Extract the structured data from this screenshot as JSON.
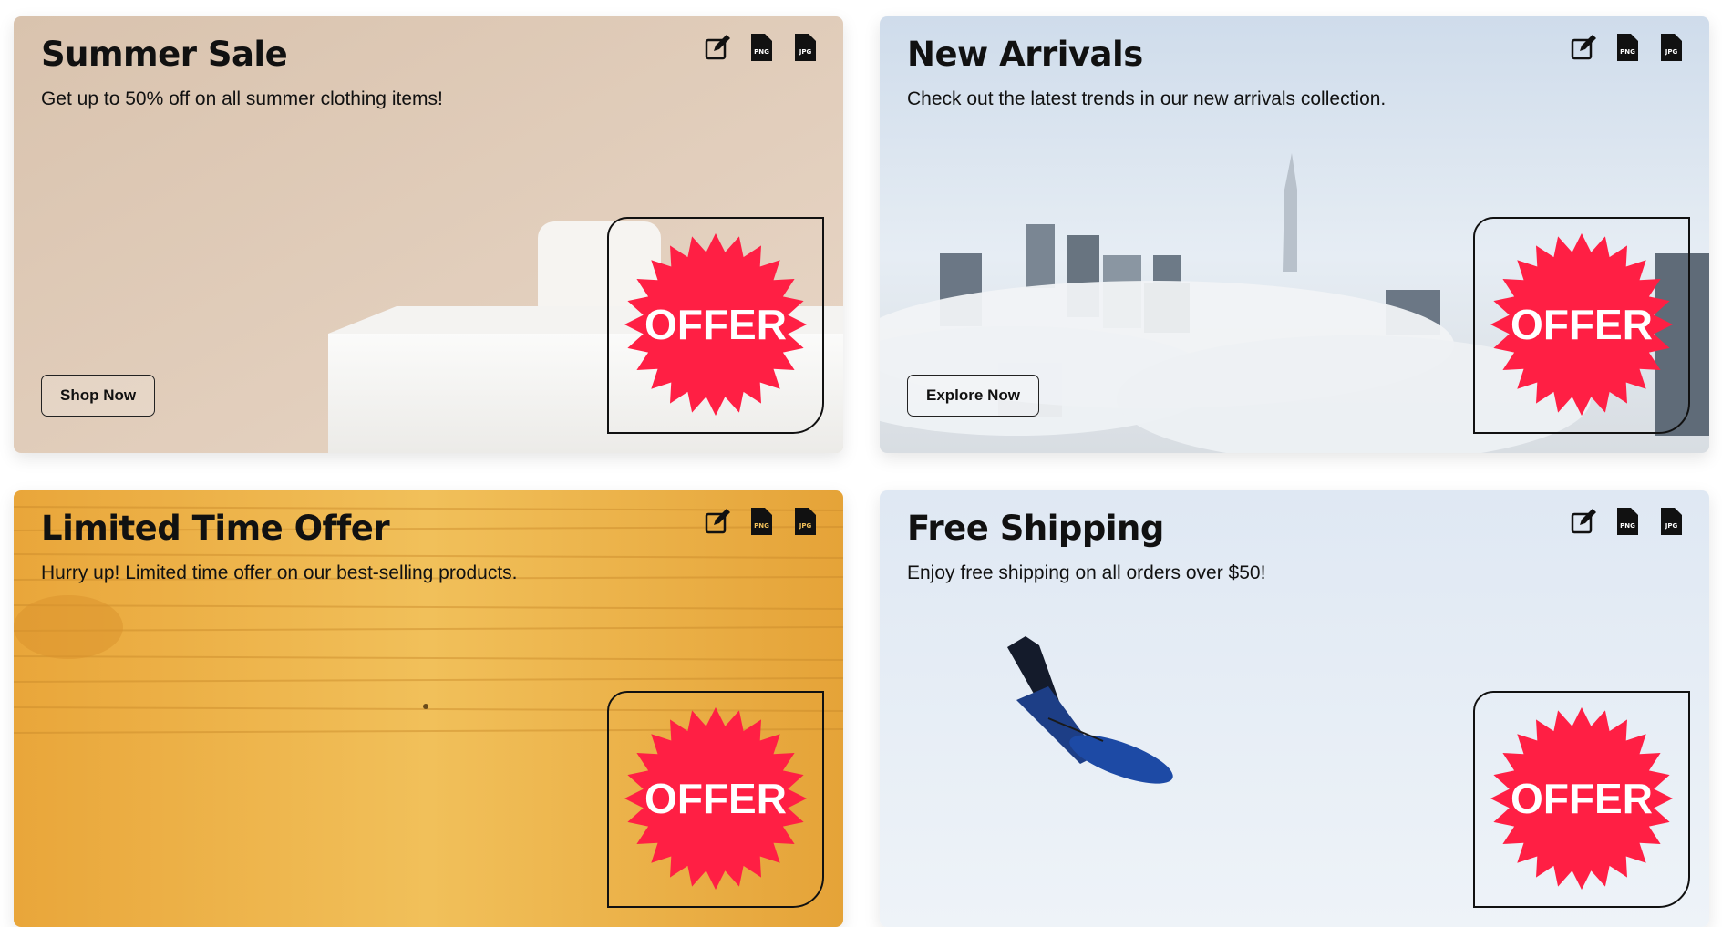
{
  "brand": {
    "badge_color": "#ff1f44"
  },
  "icons": [
    "edit-icon",
    "png-file-icon",
    "jpg-file-icon"
  ],
  "icon_labels": {
    "png": "PNG",
    "jpg": "JPG"
  },
  "cards": [
    {
      "title": "Summer Sale",
      "description": "Get up to 50% off on all summer clothing items!",
      "button": "Shop Now",
      "badge": "OFFER"
    },
    {
      "title": "New Arrivals",
      "description": "Check out the latest trends in our new arrivals collection.",
      "button": "Explore Now",
      "badge": "OFFER"
    },
    {
      "title": "Limited Time Offer",
      "description": "Hurry up! Limited time offer on our best-selling products.",
      "button": "",
      "badge": "OFFER"
    },
    {
      "title": "Free Shipping",
      "description": "Enjoy free shipping on all orders over $50!",
      "button": "",
      "badge": "OFFER"
    }
  ]
}
